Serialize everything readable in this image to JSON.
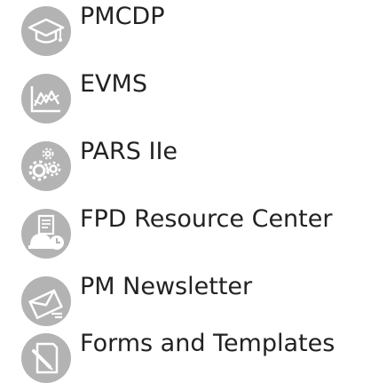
{
  "links": [
    {
      "label": "PMCDP",
      "icon": "graduation-cap-icon"
    },
    {
      "label": "EVMS",
      "icon": "chart-icon"
    },
    {
      "label": "PARS IIe",
      "icon": "gears-icon"
    },
    {
      "label": "FPD Resource Center",
      "icon": "hardhat-calendar-icon"
    },
    {
      "label": "PM Newsletter",
      "icon": "envelope-icon"
    },
    {
      "label": "Forms and Templates",
      "icon": "pen-paper-icon"
    }
  ],
  "colors": {
    "icon_circle": "#b3b3b3",
    "icon_glyph": "#ffffff",
    "text": "#222222"
  }
}
